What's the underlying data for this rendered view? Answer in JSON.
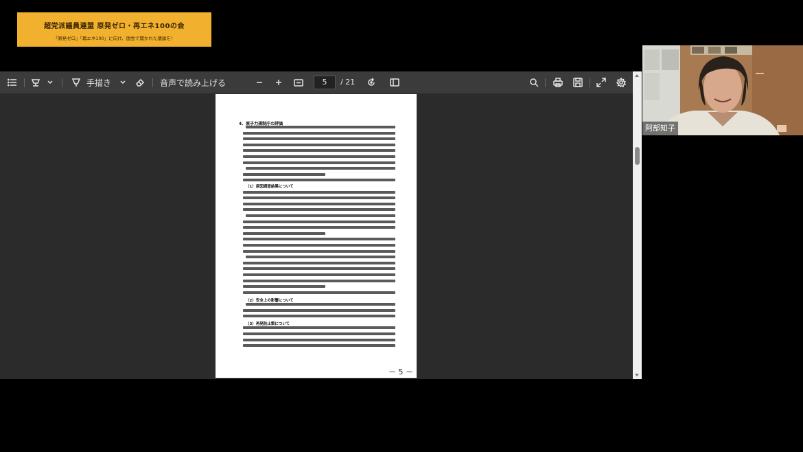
{
  "banner": {
    "title": "超党派議員連盟 原発ゼロ・再エネ100の会",
    "subtitle": "「原発ゼロ」「再エネ100」に向け、国会で開かれた議論を！"
  },
  "toolbar": {
    "draw_label": "手描き",
    "read_aloud_label": "音声で読み上げる",
    "page_current": "5",
    "page_total": "/ 21"
  },
  "document": {
    "page_footer": "－ 5 －",
    "section_heading": "4．原子力規制庁の評価",
    "subheading_1": "（1）原因調査結果について",
    "subheading_2": "（2）安全上の影響について",
    "subheading_3": "（3）再発防止策について"
  },
  "participant": {
    "name": "阿部知子"
  },
  "colors": {
    "banner_bg": "#f2b02f",
    "toolbar_bg": "#3b3b3b",
    "viewer_bg": "#2b2b2b"
  }
}
